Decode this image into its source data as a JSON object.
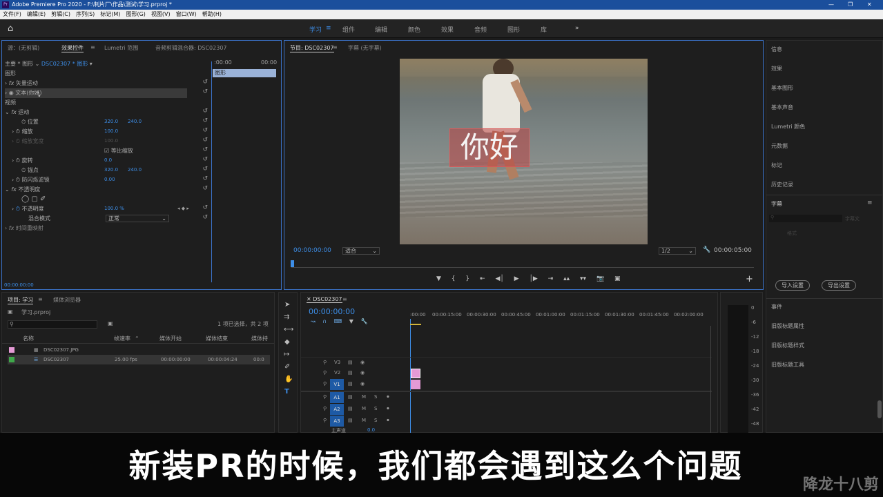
{
  "window": {
    "title": "Adobe Premiere Pro 2020 - F:\\制片厂\\作品\\测试\\学习.prproj *"
  },
  "menu": [
    "文件(F)",
    "编辑(E)",
    "剪辑(C)",
    "序列(S)",
    "标记(M)",
    "图形(G)",
    "视图(V)",
    "窗口(W)",
    "帮助(H)"
  ],
  "workspaces": [
    "学习",
    "组件",
    "编辑",
    "颜色",
    "效果",
    "音频",
    "图形",
    "库"
  ],
  "source_panel": {
    "tabs": [
      "源：(无剪辑)",
      "效果控件",
      "Lumetri 范围",
      "音频剪辑混合器: DSC02307"
    ],
    "master": "主要 * 图形",
    "clip": "DSC02307 * 图形",
    "t0": ":00:00",
    "t1": "00:00",
    "track_label": "图形",
    "section_graphic": "图形",
    "vector_motion": "矢量运动",
    "text_layer": "文本(你好)",
    "section_video": "视频",
    "motion": "运动",
    "position": "位置",
    "pos_x": "320.0",
    "pos_y": "240.0",
    "scale": "缩放",
    "scale_v": "100.0",
    "scale_w": "缩放宽度",
    "scale_w_v": "100.0",
    "uniform": "等比缩放",
    "rotation": "旋转",
    "rotation_v": "0.0",
    "anchor": "锚点",
    "anchor_x": "320.0",
    "anchor_y": "240.0",
    "antiflicker": "防闪烁滤镜",
    "antiflicker_v": "0.00",
    "opacity_group": "不透明度",
    "opacity": "不透明度",
    "opacity_v": "100.0 %",
    "blend": "混合模式",
    "blend_v": "正常",
    "timeremap": "时间重映射",
    "timecode": "00:00:00:00"
  },
  "program": {
    "tabs": [
      "节目: DSC02307",
      "字幕 (无字幕)"
    ],
    "overlay_text": "你好",
    "timecode": "00:00:00:00",
    "fit": "适合",
    "res": "1/2",
    "duration": "00:00:05:00"
  },
  "project": {
    "tabs": [
      "项目: 学习",
      "媒体浏览器"
    ],
    "file": "学习.prproj",
    "selection": "1 项已选择，共 2 项",
    "headers": [
      "名称",
      "帧速率",
      "媒体开始",
      "媒体结束",
      "媒体持"
    ],
    "items": [
      {
        "name": "DSC02307.JPG",
        "fps": "",
        "start": "",
        "end": "",
        "dur": "",
        "color": "#e59ad6"
      },
      {
        "name": "DSC02307",
        "fps": "25.00 fps",
        "start": "00:00:00:00",
        "end": "00:00:04:24",
        "dur": "00:0",
        "color": "#3fa84a"
      }
    ]
  },
  "timeline": {
    "tab": "DSC02307",
    "timecode": "00:00:00:00",
    "ruler": [
      ":00:00",
      "00:00:15:00",
      "00:00:30:00",
      "00:00:45:00",
      "00:01:00:00",
      "00:01:15:00",
      "00:01:30:00",
      "00:01:45:00",
      "00:02:00:00"
    ],
    "vtracks": [
      "V3",
      "V2",
      "V1"
    ],
    "atracks": [
      "A1",
      "A2",
      "A3"
    ],
    "master": "主声道",
    "master_v": "0.0"
  },
  "meter": {
    "marks": [
      "0",
      "-6",
      "-12",
      "-18",
      "-24",
      "-30",
      "-36",
      "-42",
      "-48"
    ]
  },
  "right_panel": {
    "items": [
      "信息",
      "效果",
      "基本图形",
      "基本声音",
      "Lumetri 颜色",
      "元数据",
      "标记",
      "历史记录"
    ],
    "captions": "字幕",
    "cap_ph1": "字幕文",
    "cap_ph2": "格式",
    "import": "导入设置",
    "export": "导出设置",
    "events": "事件",
    "items2": [
      "旧版标题属性",
      "旧版标题样式",
      "旧版标题工具"
    ]
  },
  "subtitle": "新装PR的时候，我们都会遇到这么个问题",
  "watermark": "降龙十八剪"
}
